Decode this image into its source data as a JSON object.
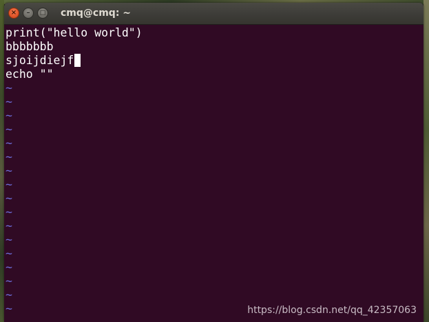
{
  "window": {
    "title": "cmq@cmq: ~",
    "controls": {
      "close": "×",
      "minimize": "–",
      "maximize": "□"
    }
  },
  "editor": {
    "lines": [
      "print(\"hello world\")",
      "bbbbbbb",
      "sjoijdiejf",
      "echo \"\""
    ],
    "empty_line_marker": "~"
  },
  "watermark": "https://blog.csdn.net/qq_42357063",
  "colors": {
    "terminal_bg": "#300a24",
    "text": "#ffffff",
    "tilde": "#6b6bd6",
    "titlebar": "#3c3b37",
    "close_button": "#e0552a"
  }
}
